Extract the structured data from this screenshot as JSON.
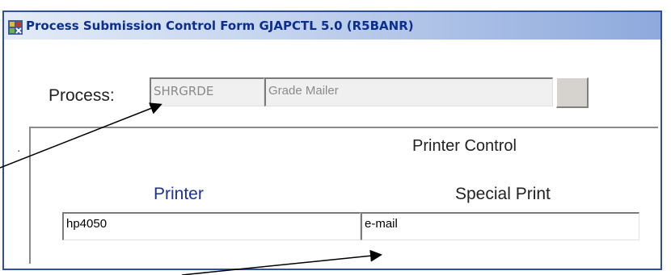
{
  "window": {
    "title": "Process Submission Control Form  GJAPCTL  5.0  (R5BANR)",
    "title_icon": "app-form-icon",
    "border_color": "#2f4f9f",
    "title_color": "#0a2f8f"
  },
  "process": {
    "label": "Process:",
    "code_value": "SHRGRDE",
    "description_value": "Grade Mailer",
    "lov_button_icon": "list-of-values-button"
  },
  "printer_control": {
    "section_title": "Printer Control",
    "printer_label": "Printer",
    "special_print_label": "Special Print",
    "printer_value": "hp4050",
    "special_print_value": "e-mail",
    "printer_label_color": "#1c2f9a"
  },
  "annotations": {
    "arrow_color": "#000000"
  }
}
